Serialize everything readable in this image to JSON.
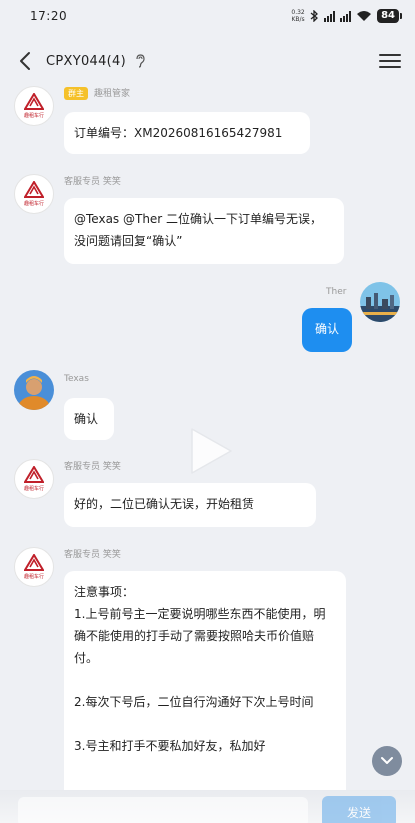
{
  "status_bar": {
    "time": "17:20",
    "net_speed_top": "0.32",
    "net_speed_bottom": "KB/s",
    "battery": "84"
  },
  "header": {
    "title": "CPXY044(4)"
  },
  "messages": [
    {
      "sender": "趣租管家",
      "tag": "群主",
      "avatar_text": "趣租车行",
      "text": "订单编号：XM20260816165427981"
    },
    {
      "sender": "客服专员 笑笑",
      "avatar_text": "趣租车行",
      "text": "@Texas @Ther 二位确认一下订单编号无误，没问题请回复“确认”"
    },
    {
      "sender": "Ther",
      "text": "确认"
    },
    {
      "sender": "Texas",
      "text": "确认"
    },
    {
      "sender": "客服专员 笑笑",
      "avatar_text": "趣租车行",
      "text": "好的，二位已确认无误，开始租赁"
    },
    {
      "sender": "客服专员 笑笑",
      "avatar_text": "趣租车行",
      "notice": {
        "title": "注意事项：",
        "p1": "1.上号前号主一定要说明哪些东西不能使用，明确不能使用的打手动了需要按照哈夫币价值赔付。",
        "p2": "2.每次下号后，二位自行沟通好下次上号时间",
        "p3": "3.号主和打手不要私加好友，私加好"
      }
    }
  ],
  "input": {
    "send_label": "发送"
  },
  "colors": {
    "background": "#eef0f4",
    "bubble_self": "#1e8ef0",
    "tag": "#f5c12a",
    "brand_red": "#c0202a"
  }
}
